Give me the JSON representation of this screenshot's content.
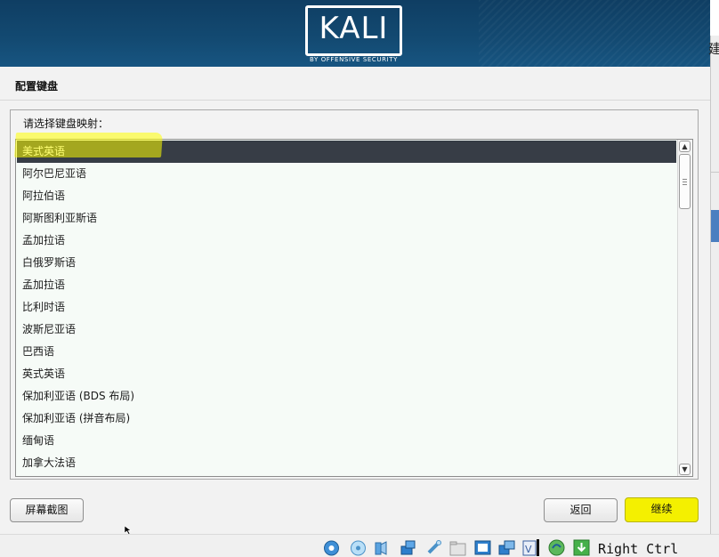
{
  "banner": {
    "logo_text": "KALI",
    "tagline": "BY OFFENSIVE SECURITY"
  },
  "host": {
    "edge_char": "建",
    "hotkey_label": "Right Ctrl"
  },
  "page": {
    "title": "配置键盘",
    "prompt": "请选择键盘映射："
  },
  "keymap_list": {
    "selected_index": 0,
    "items": [
      "美式英语",
      "阿尔巴尼亚语",
      "阿拉伯语",
      "阿斯图利亚斯语",
      "孟加拉语",
      "白俄罗斯语",
      "孟加拉语",
      "比利时语",
      "波斯尼亚语",
      "巴西语",
      "英式英语",
      "保加利亚语 (BDS 布局)",
      "保加利亚语 (拼音布局)",
      "缅甸语",
      "加拿大法语"
    ]
  },
  "buttons": {
    "screenshot": "屏幕截图",
    "back": "返回",
    "continue": "继续"
  },
  "colors": {
    "banner": "#134a72",
    "selection": "#373d46",
    "continue_button": "#f4f000",
    "highlight_marker": "#ffff00"
  },
  "statusbar_icons": [
    "hard-disk-icon",
    "optical-drive-icon",
    "audio-icon",
    "network-icon",
    "usb-icon",
    "shared-folder-icon",
    "display-icon",
    "host-network-icon",
    "recording-icon",
    "guest-additions-icon",
    "mouse-integration-icon",
    "download-icon"
  ]
}
